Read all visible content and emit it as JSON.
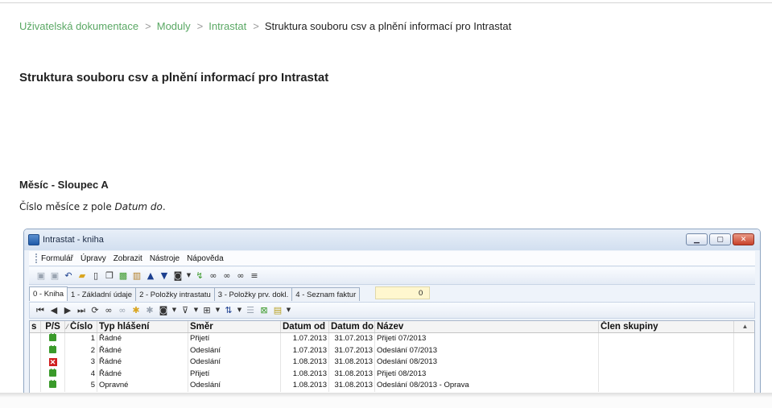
{
  "breadcrumb": {
    "items": [
      "Uživatelská dokumentace",
      "Moduly",
      "Intrastat"
    ],
    "separator": ">",
    "current": "Struktura souboru csv a plnění informací pro Intrastat"
  },
  "page_title": "Struktura souboru csv a plnění informací pro Intrastat",
  "section": {
    "heading": "Měsíc - Sloupec A",
    "text_before": "Číslo měsíce z pole ",
    "text_italic": "Datum do",
    "text_after": "."
  },
  "window": {
    "title": "Intrastat - kniha",
    "menu": [
      "Formulář",
      "Úpravy",
      "Zobrazit",
      "Nástroje",
      "Nápověda"
    ],
    "tabs": [
      "0 - Kniha",
      "1 - Základní údaje",
      "2 - Položky intrastatu",
      "3 - Položky prv. dokl.",
      "4 - Seznam faktur"
    ],
    "counter": "0",
    "columns": [
      "s",
      "P/S",
      "Číslo",
      "Typ hlášení",
      "Směr",
      "Datum od",
      "Datum do",
      "Název",
      "Člen skupiny"
    ],
    "rows": [
      {
        "status": "lock",
        "cislo": "1",
        "typ": "Řádné",
        "smer": "Přijetí",
        "od": "1.07.2013",
        "do": "31.07.2013",
        "nazev": "Přijetí 07/2013",
        "clen": ""
      },
      {
        "status": "lock",
        "cislo": "2",
        "typ": "Řádné",
        "smer": "Odeslání",
        "od": "1.07.2013",
        "do": "31.07.2013",
        "nazev": "Odeslání 07/2013",
        "clen": ""
      },
      {
        "status": "x",
        "cislo": "3",
        "typ": "Řádné",
        "smer": "Odeslání",
        "od": "1.08.2013",
        "do": "31.08.2013",
        "nazev": "Odeslání 08/2013",
        "clen": ""
      },
      {
        "status": "lock",
        "cislo": "4",
        "typ": "Řádné",
        "smer": "Přijetí",
        "od": "1.08.2013",
        "do": "31.08.2013",
        "nazev": "Přijetí 08/2013",
        "clen": ""
      },
      {
        "status": "lock",
        "cislo": "5",
        "typ": "Opravné",
        "smer": "Odeslání",
        "od": "1.08.2013",
        "do": "31.08.2013",
        "nazev": "Odeslání 08/2013 - Oprava",
        "clen": ""
      }
    ]
  },
  "colors": {
    "link": "#5aa864",
    "window_border": "#8fa6c2",
    "close_button": "#c8412a"
  }
}
